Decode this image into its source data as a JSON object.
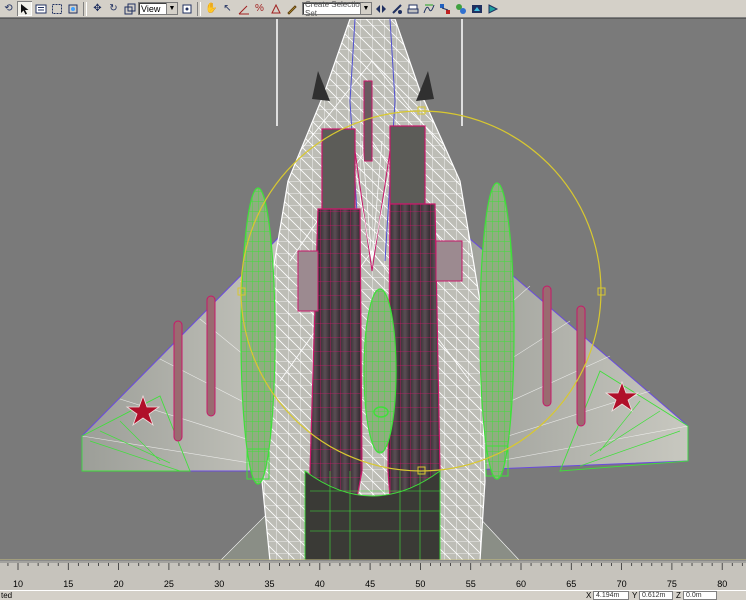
{
  "toolbar": {
    "view_label": "View",
    "selection_set_placeholder": "Create Selection Set"
  },
  "timeline": {
    "ticks": [
      "10",
      "15",
      "20",
      "25",
      "30",
      "35",
      "40",
      "45",
      "50",
      "55",
      "60",
      "65",
      "70",
      "75",
      "80"
    ]
  },
  "status": {
    "left_text": "ted",
    "x_label": "X",
    "x_value": "4.194m",
    "y_label": "Y",
    "y_value": "0.612m",
    "z_label": "Z",
    "z_value": "0.0m"
  },
  "colors": {
    "viewport_bg": "#7a7a7a",
    "wire_white": "#ffffff",
    "wire_magenta": "#c8186a",
    "wire_green": "#3fe03a",
    "gizmo_yellow": "#d8c830",
    "star_red": "#b0102a"
  }
}
